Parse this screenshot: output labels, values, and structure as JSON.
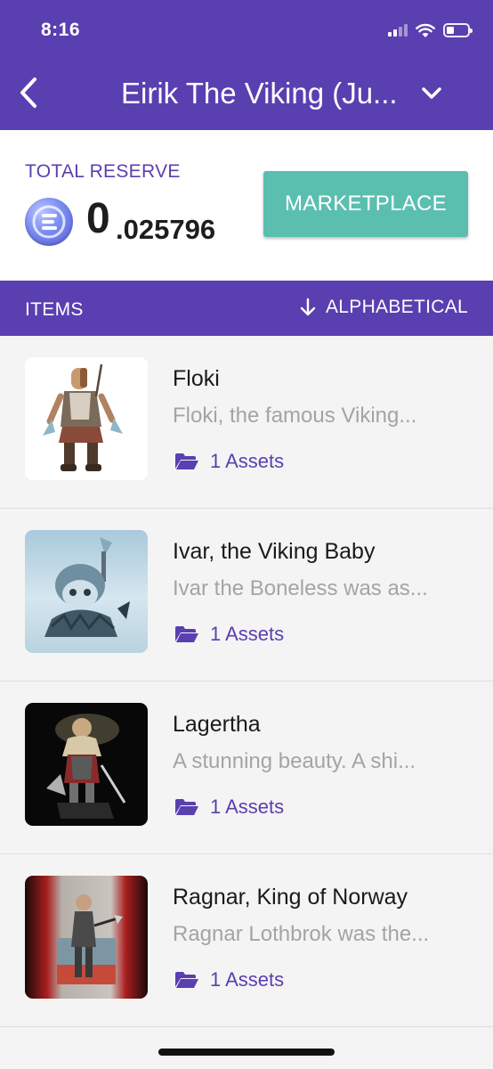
{
  "status_bar": {
    "time": "8:16"
  },
  "header": {
    "title": "Eirik The Viking (Ju..."
  },
  "reserve": {
    "label": "TOTAL RESERVE",
    "amount_integer": "0",
    "amount_decimal": ".025796",
    "marketplace_label": "MARKETPLACE"
  },
  "items_bar": {
    "label": "ITEMS",
    "sort_label": "ALPHABETICAL"
  },
  "items": [
    {
      "title": "Floki",
      "description": "Floki, the famous Viking...",
      "assets": "1 Assets"
    },
    {
      "title": "Ivar, the Viking Baby",
      "description": "Ivar the Boneless was as...",
      "assets": "1 Assets"
    },
    {
      "title": "Lagertha",
      "description": "A  stunning beauty. A shi...",
      "assets": "1 Assets"
    },
    {
      "title": "Ragnar, King of Norway",
      "description": "Ragnar Lothbrok was the...",
      "assets": "1 Assets"
    }
  ],
  "colors": {
    "primary": "#5a3fb0",
    "accent": "#5bbfb0",
    "muted_text": "#a4a4a4"
  },
  "icons": {
    "back": "chevron-left-icon",
    "dropdown": "chevron-down-icon",
    "sort": "arrow-down-icon",
    "assets": "folder-open-icon",
    "currency": "enjin-coin-icon"
  }
}
